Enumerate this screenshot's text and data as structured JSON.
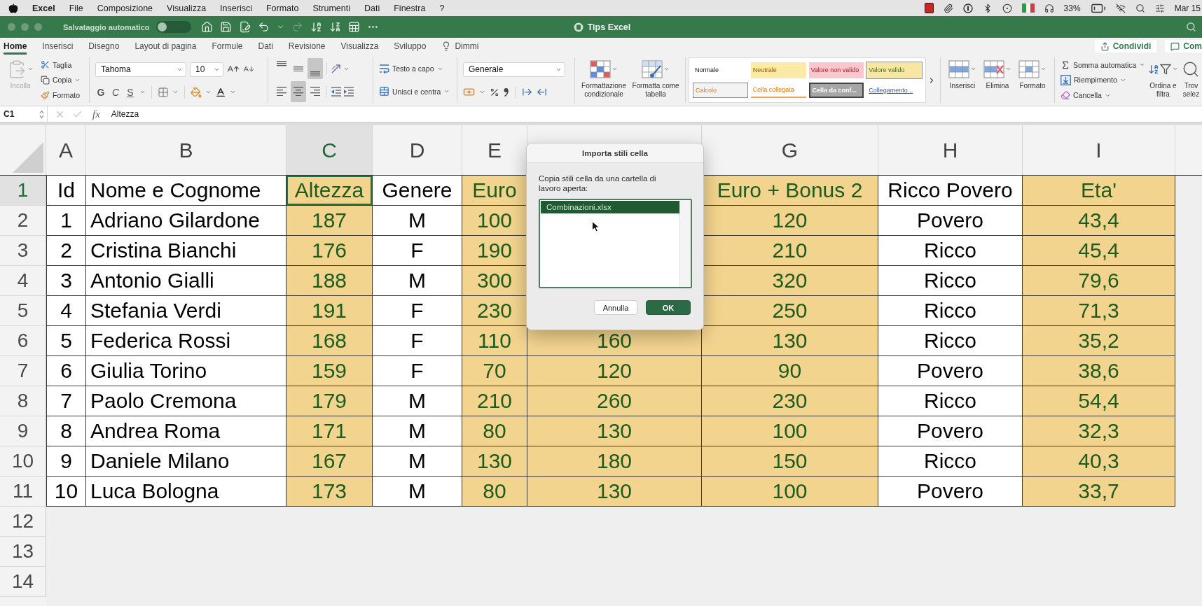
{
  "menu_bar": {
    "app": "Excel",
    "items": [
      "File",
      "Composizione",
      "Visualizza",
      "Inserisci",
      "Formato",
      "Strumenti",
      "Dati",
      "Finestra",
      "?"
    ],
    "battery": "33%",
    "clock": "Mar 15"
  },
  "title_bar": {
    "autosave_label": "Salvataggio automatico",
    "autosave_on": false,
    "redo_disabled": true,
    "title": "Tips Excel"
  },
  "ribbon_tabs": [
    {
      "label": "Home",
      "selected": true,
      "kind": "tab"
    },
    {
      "label": "Inserisci",
      "selected": false,
      "kind": "tab"
    },
    {
      "label": "Disegno",
      "selected": false,
      "kind": "tab"
    },
    {
      "label": "Layout di pagina",
      "selected": false,
      "kind": "tab"
    },
    {
      "label": "Formule",
      "selected": false,
      "kind": "tab"
    },
    {
      "label": "Dati",
      "selected": false,
      "kind": "tab"
    },
    {
      "label": "Revisione",
      "selected": false,
      "kind": "tab"
    },
    {
      "label": "Visualizza",
      "selected": false,
      "kind": "tab"
    },
    {
      "label": "Sviluppo",
      "selected": false,
      "kind": "tab"
    },
    {
      "label": "Dimmi",
      "selected": false,
      "kind": "tell_me"
    }
  ],
  "share_buttons": [
    {
      "label": "Condividi",
      "kind": "share"
    },
    {
      "label": "Com",
      "kind": "comments"
    }
  ],
  "ribbon": {
    "clipboard": {
      "paste": {
        "label": "Incolla",
        "disabled": true
      },
      "cut": "Taglia",
      "copy": "Copia",
      "format_painter": "Formato"
    },
    "font": {
      "name": "Tahoma",
      "size": "10",
      "bold": "G",
      "italic": "C",
      "underline": "S"
    },
    "alignment": {
      "vertical": [
        {
          "kind": "top",
          "selected": false
        },
        {
          "kind": "middle",
          "selected": false
        },
        {
          "kind": "bottom",
          "selected": true
        }
      ],
      "horizontal": [
        {
          "kind": "left",
          "selected": false
        },
        {
          "kind": "center",
          "selected": true
        },
        {
          "kind": "right",
          "selected": false
        }
      ],
      "wrap": "Testo a capo",
      "merge": "Unisci e centra"
    },
    "number": {
      "format": "Generale"
    },
    "format_buttons": [
      {
        "kind": "conditional",
        "label": "Formattazione condizionale"
      },
      {
        "kind": "table",
        "label": "Formatta come tabella"
      }
    ],
    "styles": [
      {
        "label": "Normale",
        "kind": "normal",
        "selected": false
      },
      {
        "label": "Neutrale",
        "kind": "neutral",
        "selected": false
      },
      {
        "label": "Valore non valido",
        "kind": "bad",
        "selected": false
      },
      {
        "label": "Valore valido",
        "kind": "good",
        "selected": true
      },
      {
        "label": "Calcolo",
        "kind": "calc",
        "selected": false
      },
      {
        "label": "Cella collegata",
        "kind": "linked",
        "selected": false
      },
      {
        "label": "Cella da conf...",
        "kind": "check",
        "selected": false
      },
      {
        "label": "Collegamento...",
        "kind": "hyperlink",
        "selected": false
      }
    ],
    "cells": [
      {
        "kind": "insert",
        "label": "Inserisci"
      },
      {
        "kind": "delete",
        "label": "Elimina"
      },
      {
        "kind": "format",
        "label": "Formato"
      }
    ],
    "editing": {
      "autosum": "Somma automatica",
      "fill": "Riempimento",
      "clear": "Cancella",
      "sort": "Ordina e filtra",
      "find": "Trov selez"
    }
  },
  "formula_bar": {
    "name_box": "C1",
    "function_label": "fx",
    "formula": "Altezza"
  },
  "sheet": {
    "columns": [
      {
        "letter": "A",
        "filled": false,
        "selected": false
      },
      {
        "letter": "B",
        "filled": false,
        "selected": false
      },
      {
        "letter": "C",
        "filled": true,
        "selected": true
      },
      {
        "letter": "D",
        "filled": false,
        "selected": false
      },
      {
        "letter": "E",
        "filled": true,
        "selected": false
      },
      {
        "filled": true,
        "selected": false
      },
      {
        "letter": "G",
        "filled": true,
        "selected": false
      },
      {
        "letter": "H",
        "filled": false,
        "selected": false
      },
      {
        "letter": "I",
        "filled": true,
        "selected": false
      }
    ],
    "rows": [
      {
        "number": "1",
        "selected": true,
        "cells": [
          "Id",
          "Nome e Cognome",
          "Altezza",
          "Genere",
          "Euro",
          null,
          "Euro + Bonus 2",
          "Ricco Povero",
          "Eta'"
        ]
      },
      {
        "number": "2",
        "selected": false,
        "cells": [
          "1",
          "Adriano Gilardone",
          "187",
          "M",
          "100",
          null,
          "120",
          "Povero",
          "43,4"
        ]
      },
      {
        "number": "3",
        "selected": false,
        "cells": [
          "2",
          "Cristina Bianchi",
          "176",
          "F",
          "190",
          null,
          "210",
          "Ricco",
          "45,4"
        ]
      },
      {
        "number": "4",
        "selected": false,
        "cells": [
          "3",
          "Antonio Gialli",
          "188",
          "M",
          "300",
          null,
          "320",
          "Ricco",
          "79,6"
        ]
      },
      {
        "number": "5",
        "selected": false,
        "cells": [
          "4",
          "Stefania Verdi",
          "191",
          "F",
          "230",
          null,
          "250",
          "Ricco",
          "71,3"
        ]
      },
      {
        "number": "6",
        "selected": false,
        "cells": [
          "5",
          "Federica Rossi",
          "168",
          "F",
          "110",
          "160",
          "130",
          "Ricco",
          "35,2"
        ]
      },
      {
        "number": "7",
        "selected": false,
        "cells": [
          "6",
          "Giulia Torino",
          "159",
          "F",
          "70",
          "120",
          "90",
          "Povero",
          "38,6"
        ]
      },
      {
        "number": "8",
        "selected": false,
        "cells": [
          "7",
          "Paolo Cremona",
          "179",
          "M",
          "210",
          "260",
          "230",
          "Ricco",
          "54,4"
        ]
      },
      {
        "number": "9",
        "selected": false,
        "cells": [
          "8",
          "Andrea Roma",
          "171",
          "M",
          "80",
          "130",
          "100",
          "Povero",
          "32,3"
        ]
      },
      {
        "number": "10",
        "selected": false,
        "cells": [
          "9",
          "Daniele Milano",
          "167",
          "M",
          "130",
          "180",
          "150",
          "Ricco",
          "40,3"
        ]
      },
      {
        "number": "11",
        "selected": false,
        "cells": [
          "10",
          "Luca Bologna",
          "173",
          "M",
          "80",
          "130",
          "100",
          "Povero",
          "33,7"
        ]
      },
      {
        "number": "12",
        "selected": false
      },
      {
        "number": "13",
        "selected": false
      },
      {
        "number": "14",
        "selected": false
      }
    ]
  },
  "dialog": {
    "title": "Importa stili cella",
    "prompt": "Copia stili cella da una cartella di lavoro aperta:",
    "files": [
      {
        "name": "Combinazioni.xlsx",
        "selected": true
      }
    ],
    "buttons": [
      {
        "label": "Annulla",
        "kind": "cancel"
      },
      {
        "label": "OK",
        "kind": "primary"
      }
    ]
  }
}
